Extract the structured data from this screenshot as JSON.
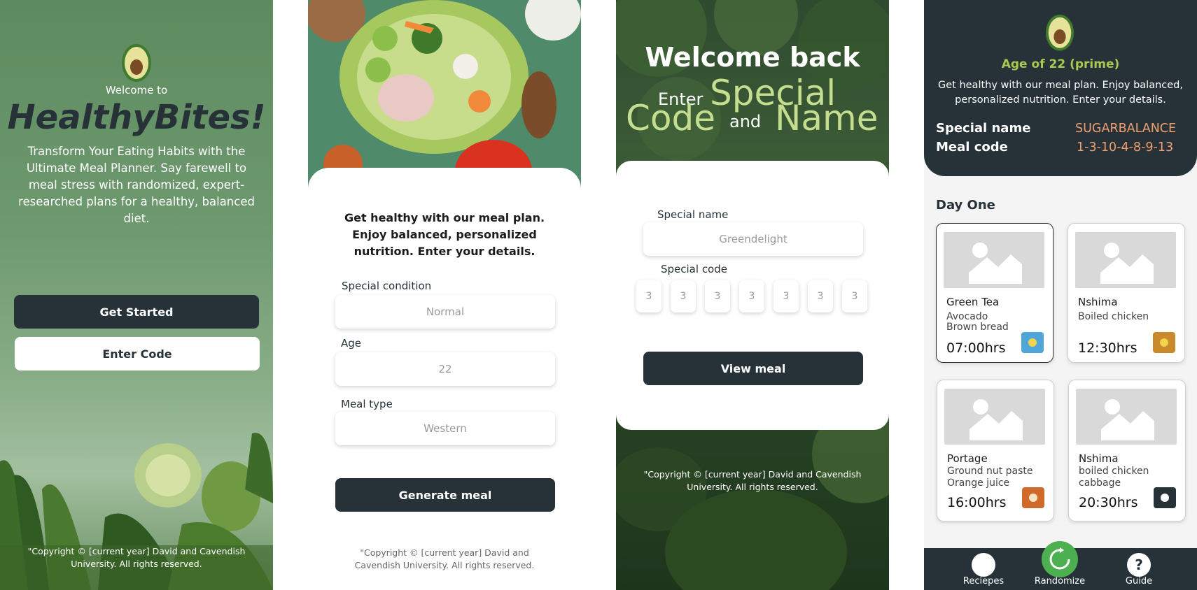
{
  "screen1": {
    "welcome": "Welcome to",
    "brand": "HealthyBites!",
    "tagline": "Transform Your Eating Habits with the Ultimate Meal Planner. Say farewell to meal stress with randomized, expert-researched plans for a healthy, balanced diet.",
    "get_started": "Get Started",
    "enter_code": "Enter Code",
    "copyright": "\"Copyright © [current year] David and Cavendish University. All rights reserved."
  },
  "screen2": {
    "intro": "Get healthy with our meal plan. Enjoy balanced, personalized nutrition. Enter your details.",
    "condition_label": "Special condition",
    "condition_value": "Normal",
    "age_label": "Age",
    "age_value": "22",
    "meal_type_label": "Meal type",
    "meal_type_value": "Western",
    "generate": "Generate meal",
    "copyright": "\"Copyright © [current year] David and Cavendish University. All rights reserved."
  },
  "screen3": {
    "welcome_back": "Welcome back",
    "enter": "Enter",
    "special": "Special",
    "code": "Code",
    "and": "and",
    "name": "Name",
    "special_name_label": "Special name",
    "special_name_placeholder": "Greendelight",
    "special_code_label": "Special code",
    "code_digits": [
      "3",
      "3",
      "3",
      "3",
      "3",
      "3",
      "3"
    ],
    "view_meal": "View meal",
    "copyright": "\"Copyright © [current year] David and Cavendish University. All rights reserved."
  },
  "screen4": {
    "age_title": "Age of 22 (prime)",
    "intro": "Get healthy with our meal plan. Enjoy balanced, personalized nutrition. Enter your details.",
    "special_name_key": "Special name",
    "special_name_value": "SUGARBALANCE",
    "meal_code_key": "Meal code",
    "meal_code_value": "1-3-10-4-8-9-13",
    "day": "Day One",
    "meals": [
      {
        "name": "Green Tea",
        "desc1": "Avocado",
        "desc2": "Brown bread",
        "time": "07:00hrs",
        "icon": "sunrise-icon"
      },
      {
        "name": "Nshima",
        "desc1": "Boiled chicken",
        "desc2": "",
        "time": "12:30hrs",
        "icon": "midday-sun-icon"
      },
      {
        "name": "Portage",
        "desc1": "Ground nut paste",
        "desc2": "Orange juice",
        "time": "16:00hrs",
        "icon": "sunset-icon"
      },
      {
        "name": "Nshima",
        "desc1": "boiled chicken",
        "desc2": "cabbage",
        "time": "20:30hrs",
        "icon": "moon-icon"
      }
    ],
    "nav": {
      "recipes": "Reciepes",
      "randomize": "Randomize",
      "guide": "Guide",
      "guide_glyph": "?"
    }
  },
  "colors": {
    "dark": "#263238",
    "green_accent": "#4caf50",
    "highlight_green": "#c5dd8e",
    "orange_value": "#f0a070",
    "age_title": "#a6c94f"
  }
}
